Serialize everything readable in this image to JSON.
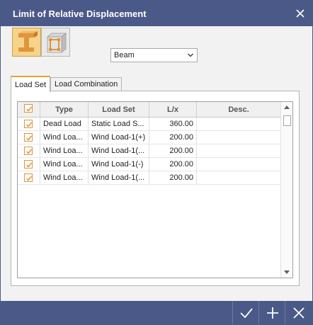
{
  "window": {
    "title": "Limit of Relative Displacement"
  },
  "mode_buttons": [
    {
      "icon": "beam-icon",
      "active": true
    },
    {
      "icon": "box-frame-icon",
      "active": false
    }
  ],
  "member_select": {
    "value": "Beam"
  },
  "tabs": [
    {
      "label": "Load Set",
      "active": true
    },
    {
      "label": "Load Combination",
      "active": false
    }
  ],
  "table": {
    "columns": [
      "",
      "Type",
      "Load Set",
      "L/x",
      "Desc."
    ],
    "rows": [
      {
        "checked": true,
        "type": "Dead Load",
        "load_set": "Static Load S...",
        "lx": "360.00",
        "desc": ""
      },
      {
        "checked": true,
        "type": "Wind Loa...",
        "load_set": "Wind Load-1(+)",
        "lx": "200.00",
        "desc": ""
      },
      {
        "checked": true,
        "type": "Wind Loa...",
        "load_set": "Wind Load-1(...",
        "lx": "200.00",
        "desc": ""
      },
      {
        "checked": true,
        "type": "Wind Loa...",
        "load_set": "Wind Load-1(-)",
        "lx": "200.00",
        "desc": ""
      },
      {
        "checked": true,
        "type": "Wind Loa...",
        "load_set": "Wind Load-1(...",
        "lx": "200.00",
        "desc": ""
      }
    ]
  },
  "footer_buttons": [
    "check-icon",
    "plus-icon",
    "close-icon"
  ],
  "colors": {
    "titlebar": "#4b5988",
    "accent": "#e6a23a",
    "check": "#e0953c"
  }
}
